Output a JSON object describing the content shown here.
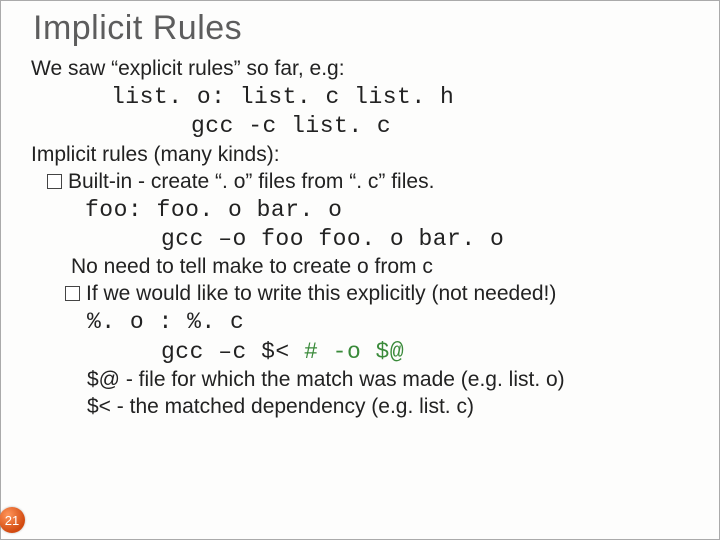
{
  "title": "Implicit Rules",
  "intro": "We saw “explicit rules” so far, e.g:",
  "explicit_example": {
    "rule": "list. o: list. c list. h",
    "cmd": "gcc -c list. c"
  },
  "implicit_heading": "Implicit rules (many kinds):",
  "builtin": {
    "text": "Built-in - create “. o” files from “. c” files.",
    "rule": "foo: foo. o bar. o",
    "cmd": "gcc –o foo foo. o bar. o",
    "note": "No need to tell make to create o from c"
  },
  "explicit_alt": {
    "lead": "If we would like to write this explicitly (not needed!)",
    "rule": "%. o : %. c",
    "cmd_prefix": "gcc –c $< ",
    "cmd_comment": "# -o $@",
    "desc1": "$@ - file for which the match was made (e.g. list. o)",
    "desc2": "$< - the matched dependency (e.g. list. c)"
  },
  "page_number": "21"
}
